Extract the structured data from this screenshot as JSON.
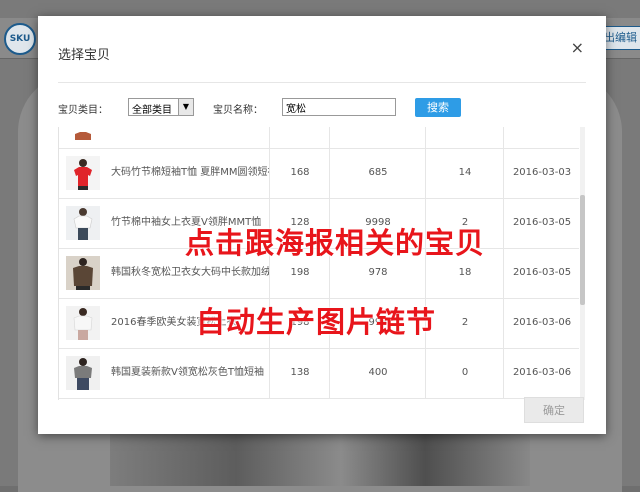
{
  "background": {
    "sku_badge": "SKU",
    "right_button": "出编辑"
  },
  "modal": {
    "title": "选择宝贝",
    "close": "×",
    "category_label": "宝贝类目：",
    "category_selected": "全部类目",
    "name_label": "宝贝名称：",
    "name_value": "宽松",
    "search_button": "搜索",
    "confirm_button": "确定",
    "rows": [
      {
        "name": "",
        "price": "",
        "sales": "",
        "stock": "",
        "date": ""
      },
      {
        "name": "大码竹节棉短袖T恤 夏胖MM圆领短袖",
        "price": "168",
        "sales": "685",
        "stock": "14",
        "date": "2016-03-03"
      },
      {
        "name": "竹节棉中袖女上衣夏V领胖MMT恤",
        "price": "128",
        "sales": "9998",
        "stock": "2",
        "date": "2016-03-05"
      },
      {
        "name": "韩国秋冬宽松卫衣女大码中长款加绒",
        "price": "198",
        "sales": "978",
        "stock": "18",
        "date": "2016-03-05"
      },
      {
        "name": "2016春季欧美女装宽松上衣",
        "price": "198",
        "sales": "998",
        "stock": "2",
        "date": "2016-03-06"
      },
      {
        "name": "韩国夏装新款V领宽松灰色T恤短袖",
        "price": "138",
        "sales": "400",
        "stock": "0",
        "date": "2016-03-06"
      }
    ]
  },
  "overlay": {
    "line1": "点击跟海报相关的宝贝",
    "line2": "自动生产图片链节"
  },
  "colors": {
    "accent": "#2e9ce6",
    "overlay_text": "#e8151b"
  }
}
